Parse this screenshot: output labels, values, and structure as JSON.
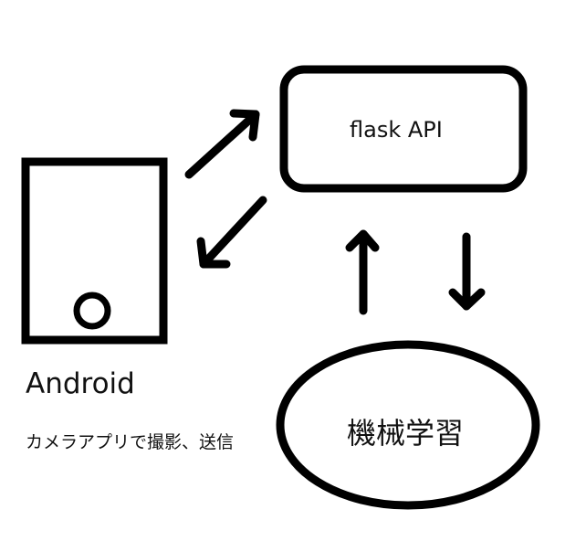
{
  "nodes": {
    "flask_api": {
      "label": "flask API"
    },
    "android": {
      "label": "Android",
      "caption": "カメラアプリで撮影、送信"
    },
    "machine_learning": {
      "label": "機械学習"
    }
  },
  "edges": [
    {
      "from": "android",
      "to": "flask_api"
    },
    {
      "from": "flask_api",
      "to": "android"
    },
    {
      "from": "machine_learning",
      "to": "flask_api"
    },
    {
      "from": "flask_api",
      "to": "machine_learning"
    }
  ],
  "colors": {
    "stroke": "#000000",
    "background": "#ffffff"
  }
}
